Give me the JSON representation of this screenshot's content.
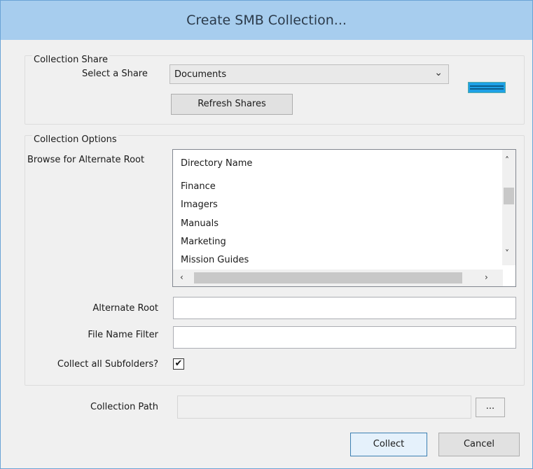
{
  "window": {
    "title": "Create SMB Collection..."
  },
  "collection_share": {
    "group_title": "Collection Share",
    "select_label": "Select a Share",
    "selected_share": "Documents",
    "refresh_button": "Refresh Shares"
  },
  "collection_options": {
    "group_title": "Collection Options",
    "browse_label": "Browse for Alternate Root",
    "column_header": "Directory Name",
    "directories": [
      "Finance",
      "Imagers",
      "Manuals",
      "Marketing",
      "Mission Guides"
    ],
    "alternate_root_label": "Alternate Root",
    "alternate_root_value": "",
    "file_filter_label": "File Name Filter",
    "file_filter_value": "",
    "subfolders_label": "Collect all Subfolders?",
    "subfolders_checked": true,
    "checkmark": "✔"
  },
  "collection_path": {
    "label": "Collection Path",
    "value": "",
    "browse_button": "..."
  },
  "buttons": {
    "collect": "Collect",
    "cancel": "Cancel"
  },
  "icons": {
    "dropdown": "chevron-down-icon",
    "scroll_up": "chevron-up-icon",
    "scroll_down": "chevron-down-icon",
    "scroll_left": "chevron-left-icon",
    "scroll_right": "chevron-right-icon",
    "logo": "brand-logo-icon"
  },
  "colors": {
    "titlebar": "#a7cdee",
    "logo": "#1ea1e6",
    "primary_border": "#3c7fb1"
  }
}
